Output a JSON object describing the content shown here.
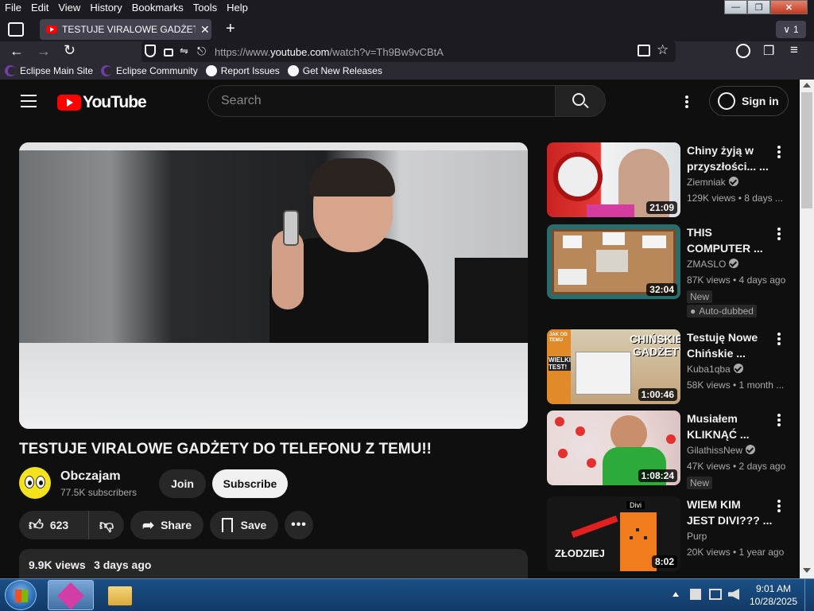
{
  "menu": [
    "File",
    "Edit",
    "View",
    "History",
    "Bookmarks",
    "Tools",
    "Help"
  ],
  "tab": {
    "title": "TESTUJE VIRALOWE GADŻETY D",
    "count": "1"
  },
  "url": {
    "prefix": "https://www.",
    "domain": "youtube.com",
    "path": "/watch?v=Th9Bw9vCBtA"
  },
  "bookmarks": [
    "Eclipse Main Site",
    "Eclipse Community",
    "Report Issues",
    "Get New Releases"
  ],
  "yt": {
    "logo": "YouTube",
    "search_placeholder": "Search",
    "sign_in": "Sign in",
    "video_title": "TESTUJE VIRALOWE GADŻETY DO TELEFONU Z TEMU!!",
    "channel": "Obczajam",
    "subscribers": "77.5K subscribers",
    "join": "Join",
    "subscribe": "Subscribe",
    "likes": "623",
    "share": "Share",
    "save": "Save",
    "views": "9.9K views",
    "uploaded": "3 days ago"
  },
  "recommended": [
    {
      "title1": "Chiny żyją w",
      "title2": "przyszłości... ...",
      "channel": "Ziemniak",
      "verified": true,
      "meta": "129K views • 8 days ...",
      "duration": "21:09",
      "badges": []
    },
    {
      "title1": "THIS",
      "title2": "COMPUTER ...",
      "channel": "ZMASLO",
      "verified": true,
      "meta": "87K views • 4 days ago",
      "duration": "32:04",
      "badges": [
        "New",
        "Auto-dubbed"
      ]
    },
    {
      "title1": "Testuję Nowe",
      "title2": "Chińskie ...",
      "channel": "Kuba1qba",
      "verified": true,
      "meta": "58K views • 1 month ...",
      "duration": "1:00:46",
      "badges": []
    },
    {
      "title1": "Musiałem",
      "title2": "KLIKNĄĆ ...",
      "channel": "GilathissNew",
      "verified": true,
      "meta": "47K views • 2 days ago",
      "duration": "1:08:24",
      "badges": [
        "New"
      ]
    },
    {
      "title1": "WIEM KIM",
      "title2": "JEST DIVI??? ...",
      "channel": "Purp",
      "verified": false,
      "meta": "20K views • 1 year ago",
      "duration": "8:02",
      "badges": []
    }
  ],
  "thumb_text": {
    "t3_top": "CHIŃSKIE",
    "t3_bottom": "GADŻETY",
    "t3_tag": "WIELKI TEST!",
    "t3_tag2": "JAK OD TEMU",
    "t5_top": "Divi",
    "t5_bottom": "ZŁODZIEJ"
  },
  "taskbar": {
    "time": "9:01 AM",
    "date": "10/28/2025"
  }
}
